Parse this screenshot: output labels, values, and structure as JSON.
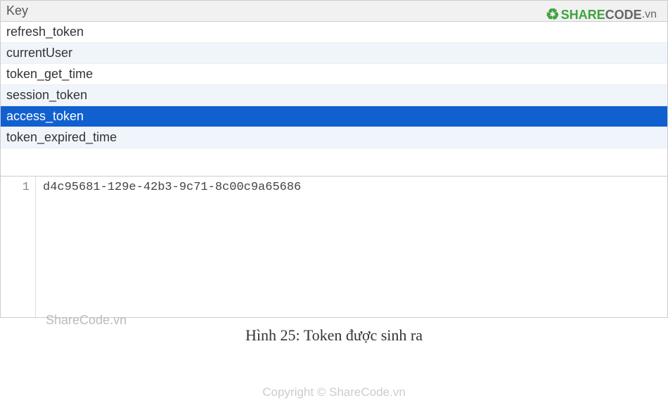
{
  "table": {
    "header": "Key",
    "rows": [
      {
        "label": "refresh_token",
        "selected": false
      },
      {
        "label": "currentUser",
        "selected": false
      },
      {
        "label": "token_get_time",
        "selected": false
      },
      {
        "label": "session_token",
        "selected": false
      },
      {
        "label": "access_token",
        "selected": true
      },
      {
        "label": "token_expired_time",
        "selected": false
      }
    ]
  },
  "value_panel": {
    "line_number": "1",
    "value": "d4c95681-129e-42b3-9c71-8c00c9a65686"
  },
  "caption": "Hình 25: Token được sinh ra",
  "watermark": {
    "brand_share": "SHARE",
    "brand_code": "CODE",
    "brand_vn": ".vn",
    "mid_text": "ShareCode.vn",
    "bottom_text": "Copyright © ShareCode.vn"
  }
}
